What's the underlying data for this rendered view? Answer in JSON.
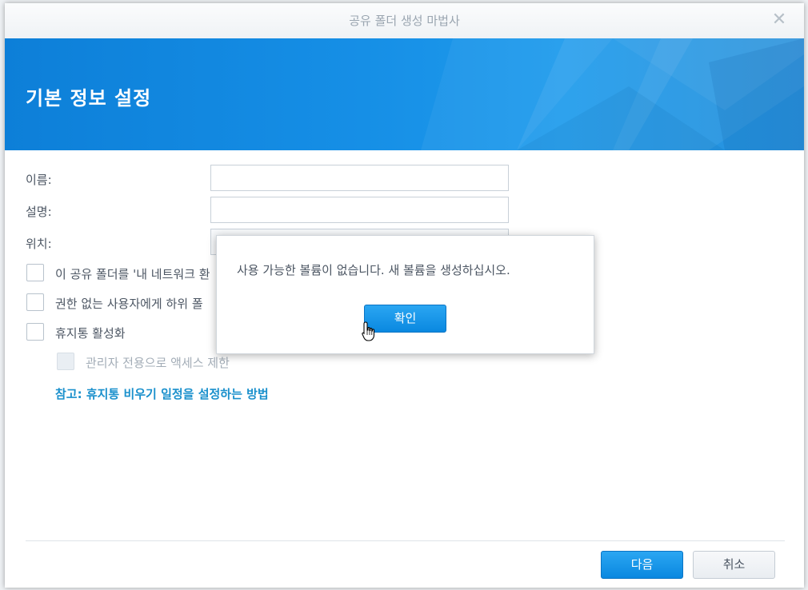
{
  "window": {
    "title": "공유 폴더 생성 마법사"
  },
  "banner": {
    "heading": "기본 정보 설정"
  },
  "form": {
    "name_label": "이름:",
    "name_value": "",
    "description_label": "설명:",
    "description_value": "",
    "location_label": "위치:",
    "checkboxes": [
      {
        "label": "이 공유 폴더를 '내 네트워크 환",
        "checked": false,
        "enabled": true
      },
      {
        "label": "권한 없는 사용자에게 하위 폴",
        "checked": false,
        "enabled": true
      },
      {
        "label": "휴지통 활성화",
        "checked": false,
        "enabled": true
      },
      {
        "label": "관리자 전용으로 액세스 제한",
        "checked": false,
        "enabled": false
      }
    ],
    "note_link": "참고: 휴지통 비우기 일정을 설정하는 방법"
  },
  "footer": {
    "next_label": "다음",
    "cancel_label": "취소"
  },
  "alert": {
    "message": "사용 가능한 볼륨이 없습니다. 새 볼륨을 생성하십시오.",
    "ok_label": "확인"
  },
  "colors": {
    "accent": "#168fe6",
    "link": "#1a90cc"
  }
}
